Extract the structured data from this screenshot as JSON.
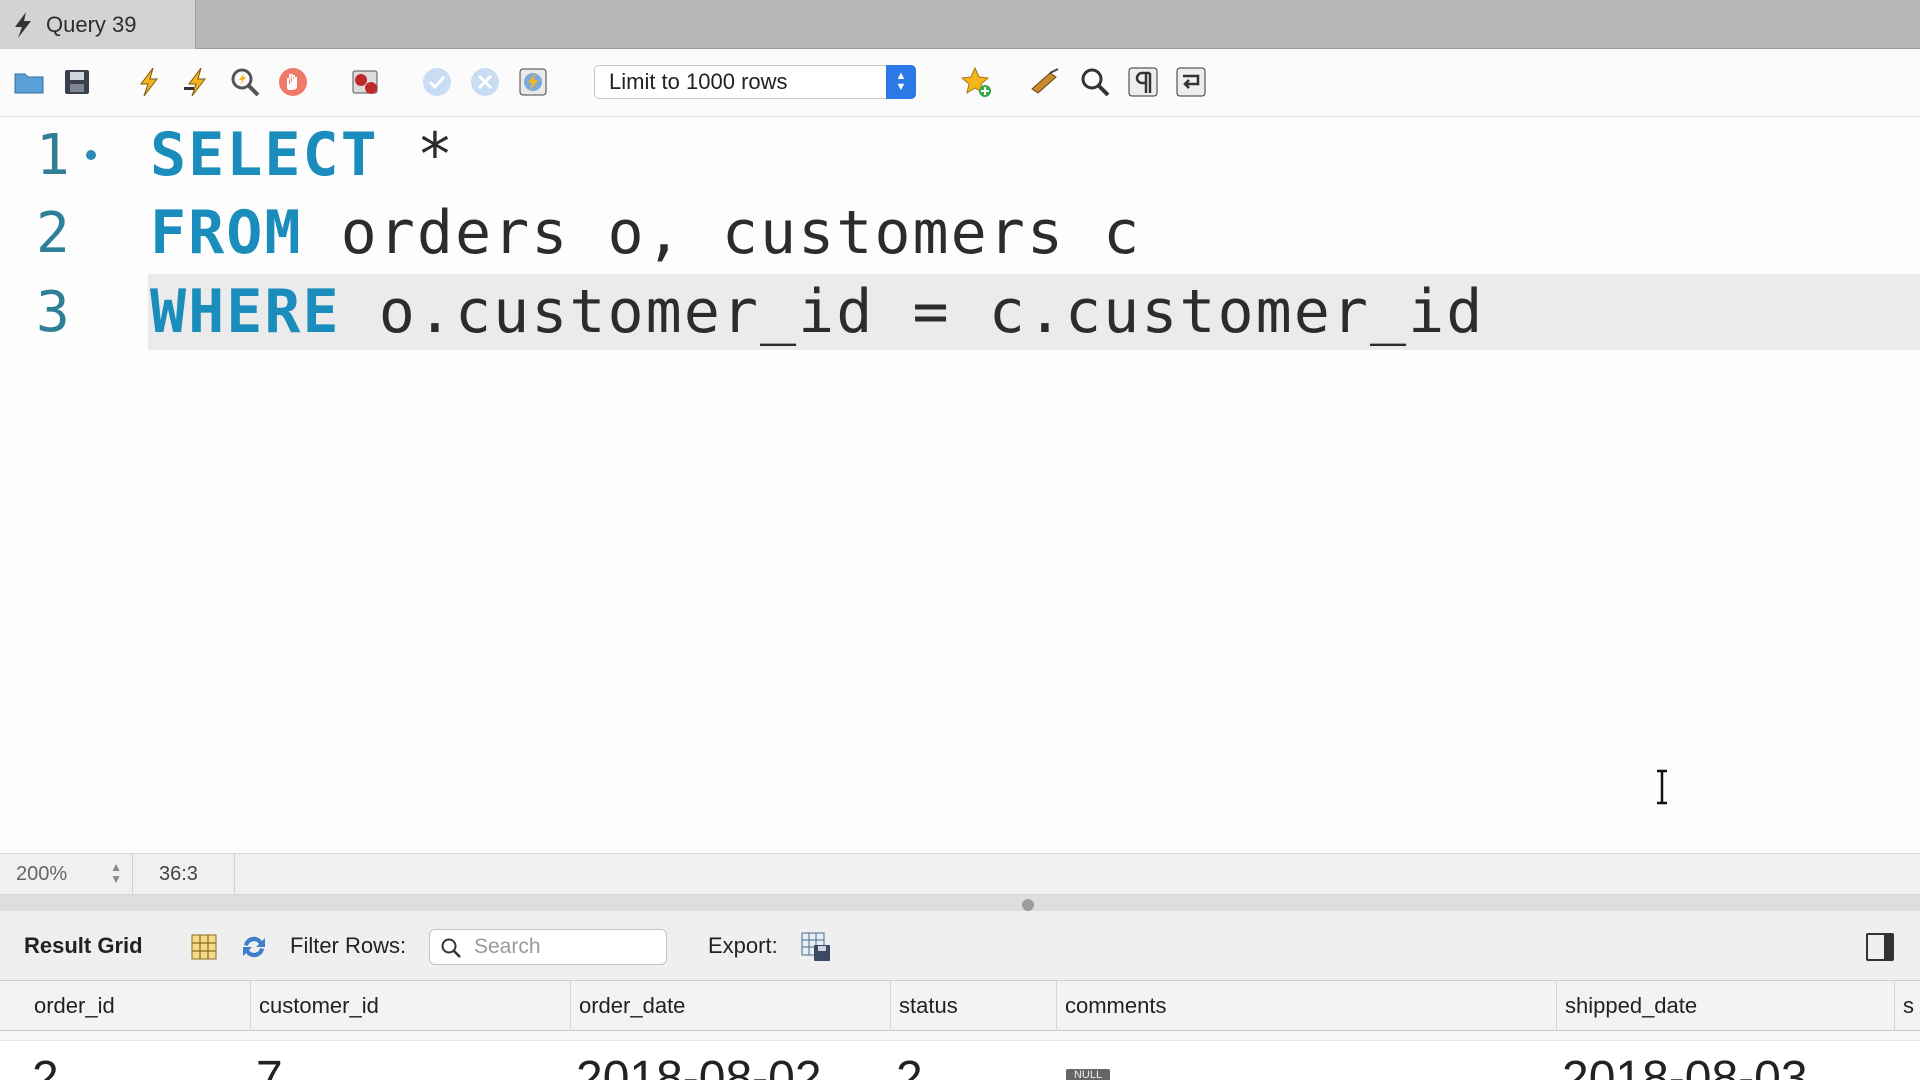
{
  "tab": {
    "title": "Query 39",
    "icon": "bolt-icon"
  },
  "toolbar": {
    "buttons": [
      "open-folder-icon",
      "save-icon",
      "execute-icon",
      "execute-current-icon",
      "explain-icon",
      "stop-icon",
      "toggle-error-icon",
      "commit-icon",
      "rollback-icon",
      "autocommit-icon"
    ],
    "limit_label": "Limit to 1000 rows",
    "right_buttons": [
      "add-snippet-icon",
      "beautify-icon",
      "find-icon",
      "invisible-chars-icon",
      "wrap-lines-icon"
    ]
  },
  "editor": {
    "lines": [
      {
        "number": "1",
        "keyword": "SELECT",
        "rest": " *"
      },
      {
        "number": "2",
        "keyword": "FROM",
        "rest": " orders o, customers c"
      },
      {
        "number": "3",
        "keyword": "WHERE",
        "rest": " o.customer_id = c.customer_id"
      }
    ]
  },
  "status": {
    "zoom": "200%",
    "position": "36:3"
  },
  "results": {
    "title": "Result Grid",
    "filter_label": "Filter Rows:",
    "search_placeholder": "Search",
    "export_label": "Export:"
  },
  "grid": {
    "columns": [
      "order_id",
      "customer_id",
      "order_date",
      "status",
      "comments",
      "shipped_date",
      "s"
    ],
    "partial_row": [
      "2",
      "7",
      "2018-08-02",
      "2",
      "NULL",
      "2018-08-03"
    ]
  }
}
